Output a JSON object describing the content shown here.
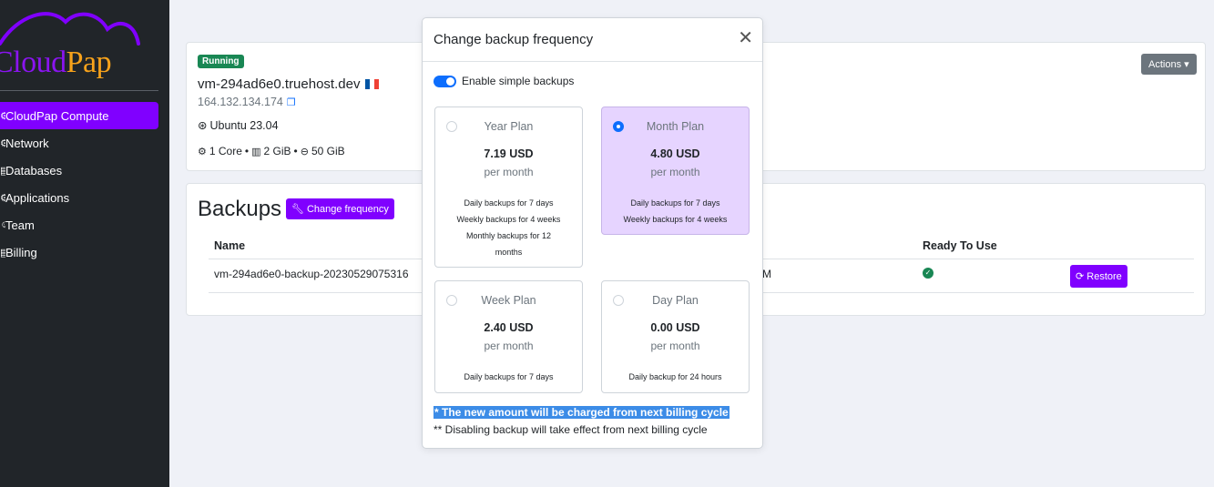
{
  "sidebar": {
    "logo": {
      "part1": "Cloud",
      "part2": "Pap"
    },
    "items": [
      {
        "icon": "⚙",
        "label": "CloudPap Compute",
        "active": true
      },
      {
        "icon": "⚙",
        "label": "Network"
      },
      {
        "icon": "▤",
        "label": "Databases"
      },
      {
        "icon": "⚙",
        "label": "Applications"
      },
      {
        "icon": "☺",
        "label": "Team"
      },
      {
        "icon": "▤",
        "label": "Billing"
      }
    ]
  },
  "vm": {
    "status": "Running",
    "name": "vm-294ad6e0.truehost.dev",
    "ip": "164.132.134.174",
    "os": "Ubuntu 23.04",
    "cores": "1 Core",
    "ram": "2 GiB",
    "disk": "50 GiB",
    "actions_label": "Actions ▾"
  },
  "backups": {
    "title": "Backups",
    "change_freq_label": "Change frequency",
    "col_name": "Name",
    "col_ready": "Ready To Use",
    "row_name": "vm-294ad6e0-backup-20230529075316",
    "row_time_fragment": "M",
    "restore_label": "Restore"
  },
  "modal": {
    "title": "Change backup frequency",
    "close": "✕",
    "toggle_label": "Enable simple backups",
    "plans": [
      {
        "name": "Year Plan",
        "price": "7.19 USD",
        "per": "per month",
        "desc": [
          "Daily backups for 7 days",
          "Weekly backups for 4 weeks",
          "Monthly backups for 12 months"
        ],
        "selected": false
      },
      {
        "name": "Month Plan",
        "price": "4.80 USD",
        "per": "per month",
        "desc": [
          "Daily backups for 7 days",
          "Weekly backups for 4 weeks"
        ],
        "selected": true
      },
      {
        "name": "Week Plan",
        "price": "2.40 USD",
        "per": "per month",
        "desc": [
          "Daily backups for 7 days"
        ],
        "selected": false
      },
      {
        "name": "Day Plan",
        "price": "0.00 USD",
        "per": "per month",
        "desc": [
          "Daily backup for 24 hours"
        ],
        "selected": false
      }
    ],
    "note1": "* The new amount will be charged from next billing cycle",
    "note2": "** Disabling backup will take effect from next billing cycle"
  },
  "colors": {
    "accent": "#8000ff",
    "sidebar_bg": "#212529",
    "success": "#198754",
    "primary": "#0d6efd",
    "logo_orange": "#f7a21b"
  }
}
